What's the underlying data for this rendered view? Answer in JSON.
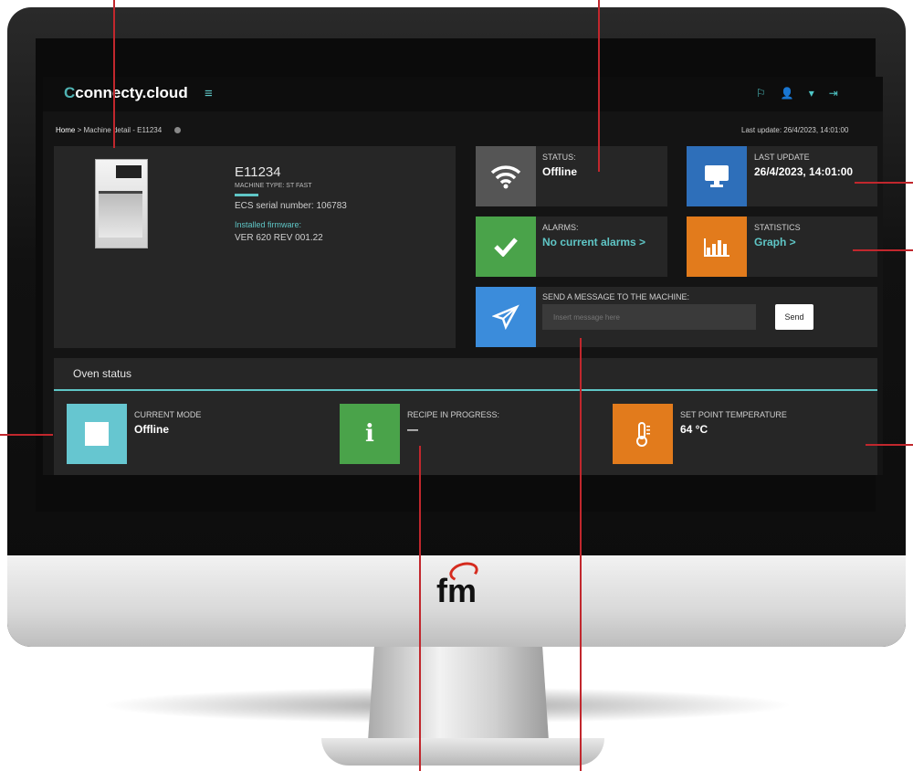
{
  "app": {
    "logo_prefix": "C",
    "logo_text": "connecty.cloud",
    "menu_icon": "hamburger-icon"
  },
  "header": {
    "icons": [
      "flag-icon",
      "user-icon",
      "caret-down-icon",
      "logout-icon"
    ],
    "icon_glyphs": [
      "⚐",
      "👤",
      "▾",
      "⇥"
    ]
  },
  "breadcrumb": {
    "home": "Home",
    "separator": ">",
    "current": "Machine detail - E11234"
  },
  "last_update_header": "Last update: 26/4/2023, 14:01:00",
  "machine": {
    "name": "E11234",
    "type": "MACHINE TYPE: ST FAST",
    "serial": "ECS serial number: 106783",
    "firmware_label": "Installed firmware:",
    "firmware_value": "VER 620 REV 001.22"
  },
  "cards": {
    "status": {
      "label": "STATUS:",
      "value": "Offline",
      "icon": "wifi-icon",
      "color": "#555555"
    },
    "last_update": {
      "label": "LAST UPDATE",
      "value": "26/4/2023, 14:01:00",
      "icon": "monitor-icon",
      "color": "#2e6fba"
    },
    "alarms": {
      "label": "ALARMS:",
      "value": "No current alarms  >",
      "icon": "check-icon",
      "color": "#4aa34a"
    },
    "statistics": {
      "label": "STATISTICS",
      "value": "Graph  >",
      "icon": "bar-chart-icon",
      "color": "#e27b1c"
    },
    "message": {
      "label": "SEND A MESSAGE TO THE MACHINE:",
      "placeholder": "Insert message here",
      "send": "Send",
      "icon": "paper-plane-icon",
      "color": "#3b8cdb"
    }
  },
  "oven_status": {
    "title": "Oven status",
    "items": [
      {
        "label": "CURRENT MODE",
        "value": "Offline",
        "icon": "square-icon",
        "color": "#66c6d0"
      },
      {
        "label": "RECIPE IN PROGRESS:",
        "value": "—",
        "icon": "info-icon",
        "color": "#4aa34a"
      },
      {
        "label": "SET POINT TEMPERATURE",
        "value": "64 °C",
        "icon": "thermometer-icon",
        "color": "#e27b1c"
      }
    ]
  },
  "brand": {
    "text": "fm"
  }
}
